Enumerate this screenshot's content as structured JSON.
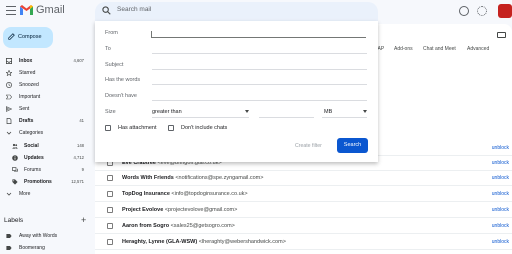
{
  "app": {
    "name": "Gmail"
  },
  "search": {
    "placeholder": "Search mail"
  },
  "compose": {
    "label": "Compose"
  },
  "sidebar": {
    "items": [
      {
        "label": "Inbox",
        "count": "4,607",
        "icon": "inbox-icon"
      },
      {
        "label": "Starred",
        "count": "",
        "icon": "star-icon"
      },
      {
        "label": "Snoozed",
        "count": "",
        "icon": "clock-icon"
      },
      {
        "label": "Important",
        "count": "",
        "icon": "label-important-icon"
      },
      {
        "label": "Sent",
        "count": "",
        "icon": "send-icon"
      },
      {
        "label": "Drafts",
        "count": "41",
        "icon": "draft-icon"
      },
      {
        "label": "Categories",
        "count": "",
        "icon": "chevron-down-icon"
      },
      {
        "label": "Social",
        "count": "148",
        "icon": "people-icon"
      },
      {
        "label": "Updates",
        "count": "4,712",
        "icon": "info-icon"
      },
      {
        "label": "Forums",
        "count": "9",
        "icon": "forum-icon"
      },
      {
        "label": "Promotions",
        "count": "12,571",
        "icon": "tag-icon"
      },
      {
        "label": "More",
        "count": "",
        "icon": "chevron-down-icon"
      }
    ],
    "labels_title": "Labels",
    "labels": [
      {
        "label": "Away with Words"
      },
      {
        "label": "Boomerang"
      }
    ]
  },
  "settings_tabs": {
    "items": [
      "IMAP",
      "Add-ons",
      "Chat and Meet",
      "Advanced"
    ]
  },
  "search_options": {
    "from_label": "From",
    "to_label": "To",
    "subject_label": "Subject",
    "has_words_label": "Has the words",
    "doesnt_have_label": "Doesn't have",
    "size_label": "Size",
    "size_operator": "greater than",
    "size_unit": "MB",
    "has_attachment_label": "Has attachment",
    "no_chats_label": "Don't include chats",
    "create_filter_label": "Create filter",
    "search_label": "Search"
  },
  "blocked": {
    "rows": [
      {
        "name": "Eve Crabtree",
        "email": "<eve@bringoff.gtal.co.uk>",
        "action": "unblock"
      },
      {
        "name": "Words With Friends",
        "email": "<notifications@spe.zyngamail.com>",
        "action": "unblock"
      },
      {
        "name": "TopDog Insurance",
        "email": "<info@topdoginsurance.co.uk>",
        "action": "unblock"
      },
      {
        "name": "Project Evolove",
        "email": "<projectevolove@gmail.com>",
        "action": "unblock"
      },
      {
        "name": "Aaron from Sogro",
        "email": "<sales25@getsogro.com>",
        "action": "unblock"
      },
      {
        "name": "Heraghty, Lynne (GLA-WSW)",
        "email": "<lheraghty@webershandwick.com>",
        "action": "unblock"
      }
    ]
  },
  "colors": {
    "accent": "#0b57d0",
    "compose_bg": "#c2e7ff",
    "gmail_red": "#ea4335"
  }
}
